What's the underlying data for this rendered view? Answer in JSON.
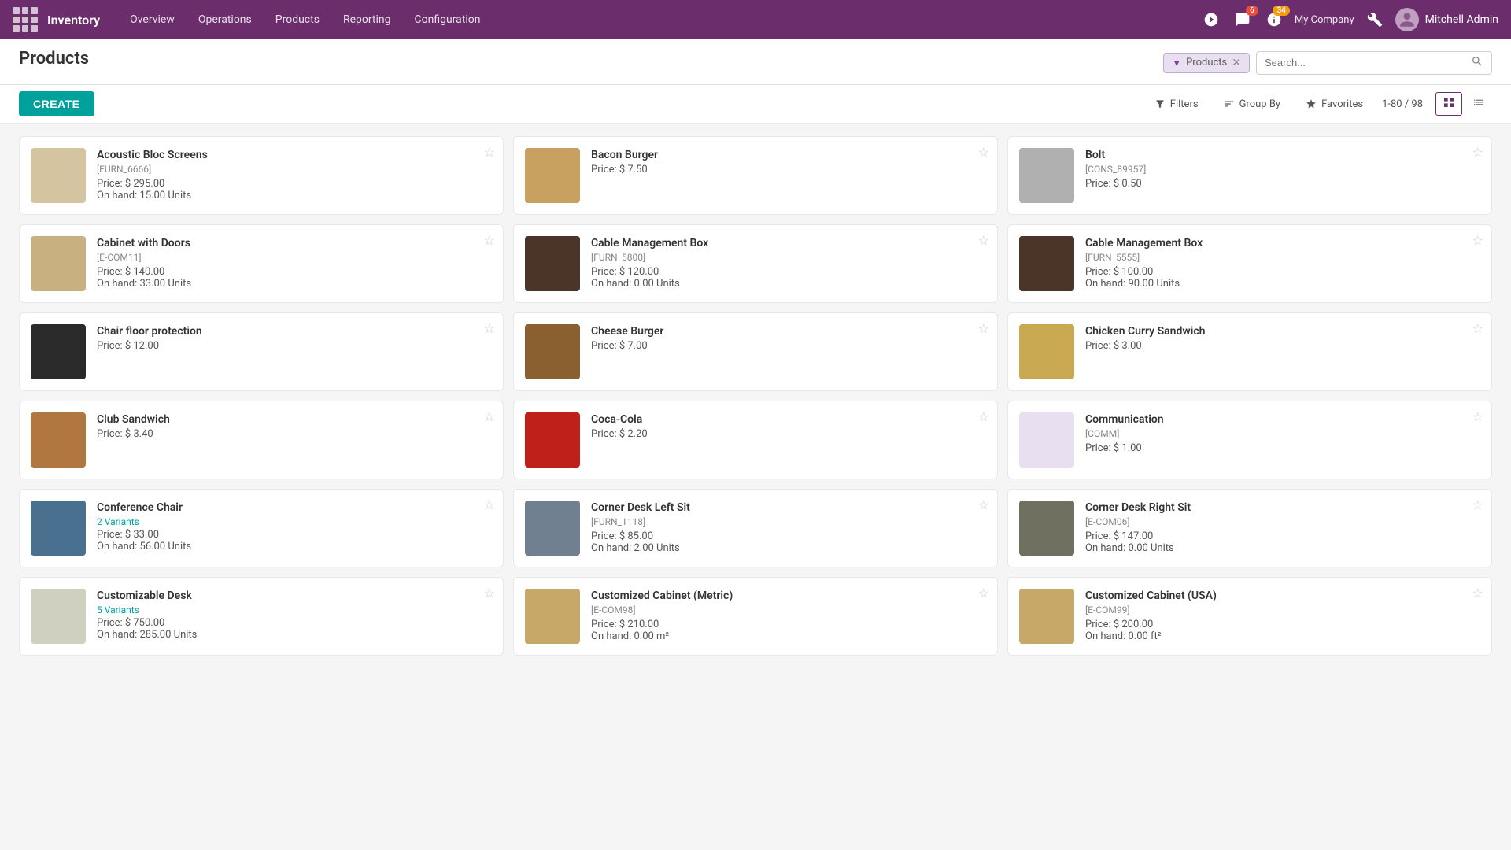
{
  "app": {
    "name": "Inventory",
    "nav_items": [
      "Overview",
      "Operations",
      "Products",
      "Reporting",
      "Configuration"
    ],
    "notifications_count": 6,
    "updates_count": 34,
    "company": "My Company",
    "user": "Mitchell Admin"
  },
  "page": {
    "title": "Products",
    "create_label": "CREATE"
  },
  "toolbar": {
    "filter_tag": "Products",
    "search_placeholder": "Search...",
    "filters_label": "Filters",
    "groupby_label": "Group By",
    "favorites_label": "Favorites",
    "pagination": "1-80 / 98"
  },
  "products": [
    {
      "name": "Acoustic Bloc Screens",
      "ref": "[FURN_6666]",
      "price": "Price: $ 295.00",
      "onhand": "On hand: 15.00 Units",
      "variants": null,
      "img_color": "#d4c5a0"
    },
    {
      "name": "Bacon Burger",
      "ref": null,
      "price": "Price: $ 7.50",
      "onhand": null,
      "variants": null,
      "img_color": "#c8a060"
    },
    {
      "name": "Bolt",
      "ref": "[CONS_89957]",
      "price": "Price: $ 0.50",
      "onhand": null,
      "variants": null,
      "img_color": "#b0b0b0"
    },
    {
      "name": "Cabinet with Doors",
      "ref": "[E-COM11]",
      "price": "Price: $ 140.00",
      "onhand": "On hand: 33.00 Units",
      "variants": null,
      "img_color": "#c8b080"
    },
    {
      "name": "Cable Management Box",
      "ref": "[FURN_5800]",
      "price": "Price: $ 120.00",
      "onhand": "On hand: 0.00 Units",
      "variants": null,
      "img_color": "#4a3528"
    },
    {
      "name": "Cable Management Box",
      "ref": "[FURN_5555]",
      "price": "Price: $ 100.00",
      "onhand": "On hand: 90.00 Units",
      "variants": null,
      "img_color": "#4a3528"
    },
    {
      "name": "Chair floor protection",
      "ref": null,
      "price": "Price: $ 12.00",
      "onhand": null,
      "variants": null,
      "img_color": "#2a2a2a"
    },
    {
      "name": "Cheese Burger",
      "ref": null,
      "price": "Price: $ 7.00",
      "onhand": null,
      "variants": null,
      "img_color": "#8a6030"
    },
    {
      "name": "Chicken Curry Sandwich",
      "ref": null,
      "price": "Price: $ 3.00",
      "onhand": null,
      "variants": null,
      "img_color": "#c8a850"
    },
    {
      "name": "Club Sandwich",
      "ref": null,
      "price": "Price: $ 3.40",
      "onhand": null,
      "variants": null,
      "img_color": "#b07840"
    },
    {
      "name": "Coca-Cola",
      "ref": null,
      "price": "Price: $ 2.20",
      "onhand": null,
      "variants": null,
      "img_color": "#c0201a"
    },
    {
      "name": "Communication",
      "ref": "[COMM]",
      "price": "Price: $ 1.00",
      "onhand": null,
      "variants": null,
      "img_color": "#e8e0f0"
    },
    {
      "name": "Conference Chair",
      "ref": null,
      "price": "Price: $ 33.00",
      "onhand": "On hand: 56.00 Units",
      "variants": "2 Variants",
      "img_color": "#4a7090"
    },
    {
      "name": "Corner Desk Left Sit",
      "ref": "[FURN_1118]",
      "price": "Price: $ 85.00",
      "onhand": "On hand: 2.00 Units",
      "variants": null,
      "img_color": "#708090"
    },
    {
      "name": "Corner Desk Right Sit",
      "ref": "[E-COM06]",
      "price": "Price: $ 147.00",
      "onhand": "On hand: 0.00 Units",
      "variants": null,
      "img_color": "#707060"
    },
    {
      "name": "Customizable Desk",
      "ref": null,
      "price": "Price: $ 750.00",
      "onhand": "On hand: 285.00 Units",
      "variants": "5 Variants",
      "img_color": "#d0d0c0"
    },
    {
      "name": "Customized Cabinet (Metric)",
      "ref": "[E-COM98]",
      "price": "Price: $ 210.00",
      "onhand": "On hand: 0.00 m²",
      "variants": null,
      "img_color": "#c8a868"
    },
    {
      "name": "Customized Cabinet (USA)",
      "ref": "[E-COM99]",
      "price": "Price: $ 200.00",
      "onhand": "On hand: 0.00 ft²",
      "variants": null,
      "img_color": "#c8a868"
    }
  ]
}
